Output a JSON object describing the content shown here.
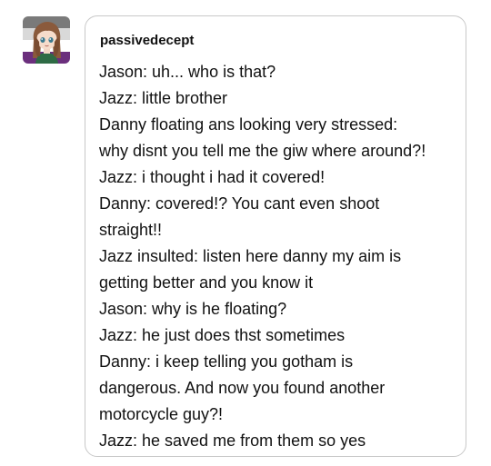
{
  "post": {
    "username": "passivedecept",
    "avatar_icon": "user-avatar-illustration",
    "lines": [
      "Jason: uh... who is that?",
      "Jazz: little brother",
      "Danny floating ans looking very stressed:",
      "why disnt you tell me the giw where around?!",
      "Jazz: i thought i had it covered!",
      "Danny: covered!? You cant even shoot",
      "straight!!",
      "Jazz insulted: listen here danny my aim is",
      "getting better and you know it",
      "Jason: why is he floating?",
      "Jazz: he just does thst sometimes",
      "Danny: i keep telling you gotham is",
      "dangerous. And now you found another",
      "motorcycle guy?!",
      "Jazz: he saved me from them so yes"
    ]
  },
  "colors": {
    "bubble_border": "#c8c8c8",
    "text": "#111111",
    "avatar_top_band": "#7a7a7a",
    "avatar_bottom_band": "#6b2f7d"
  }
}
